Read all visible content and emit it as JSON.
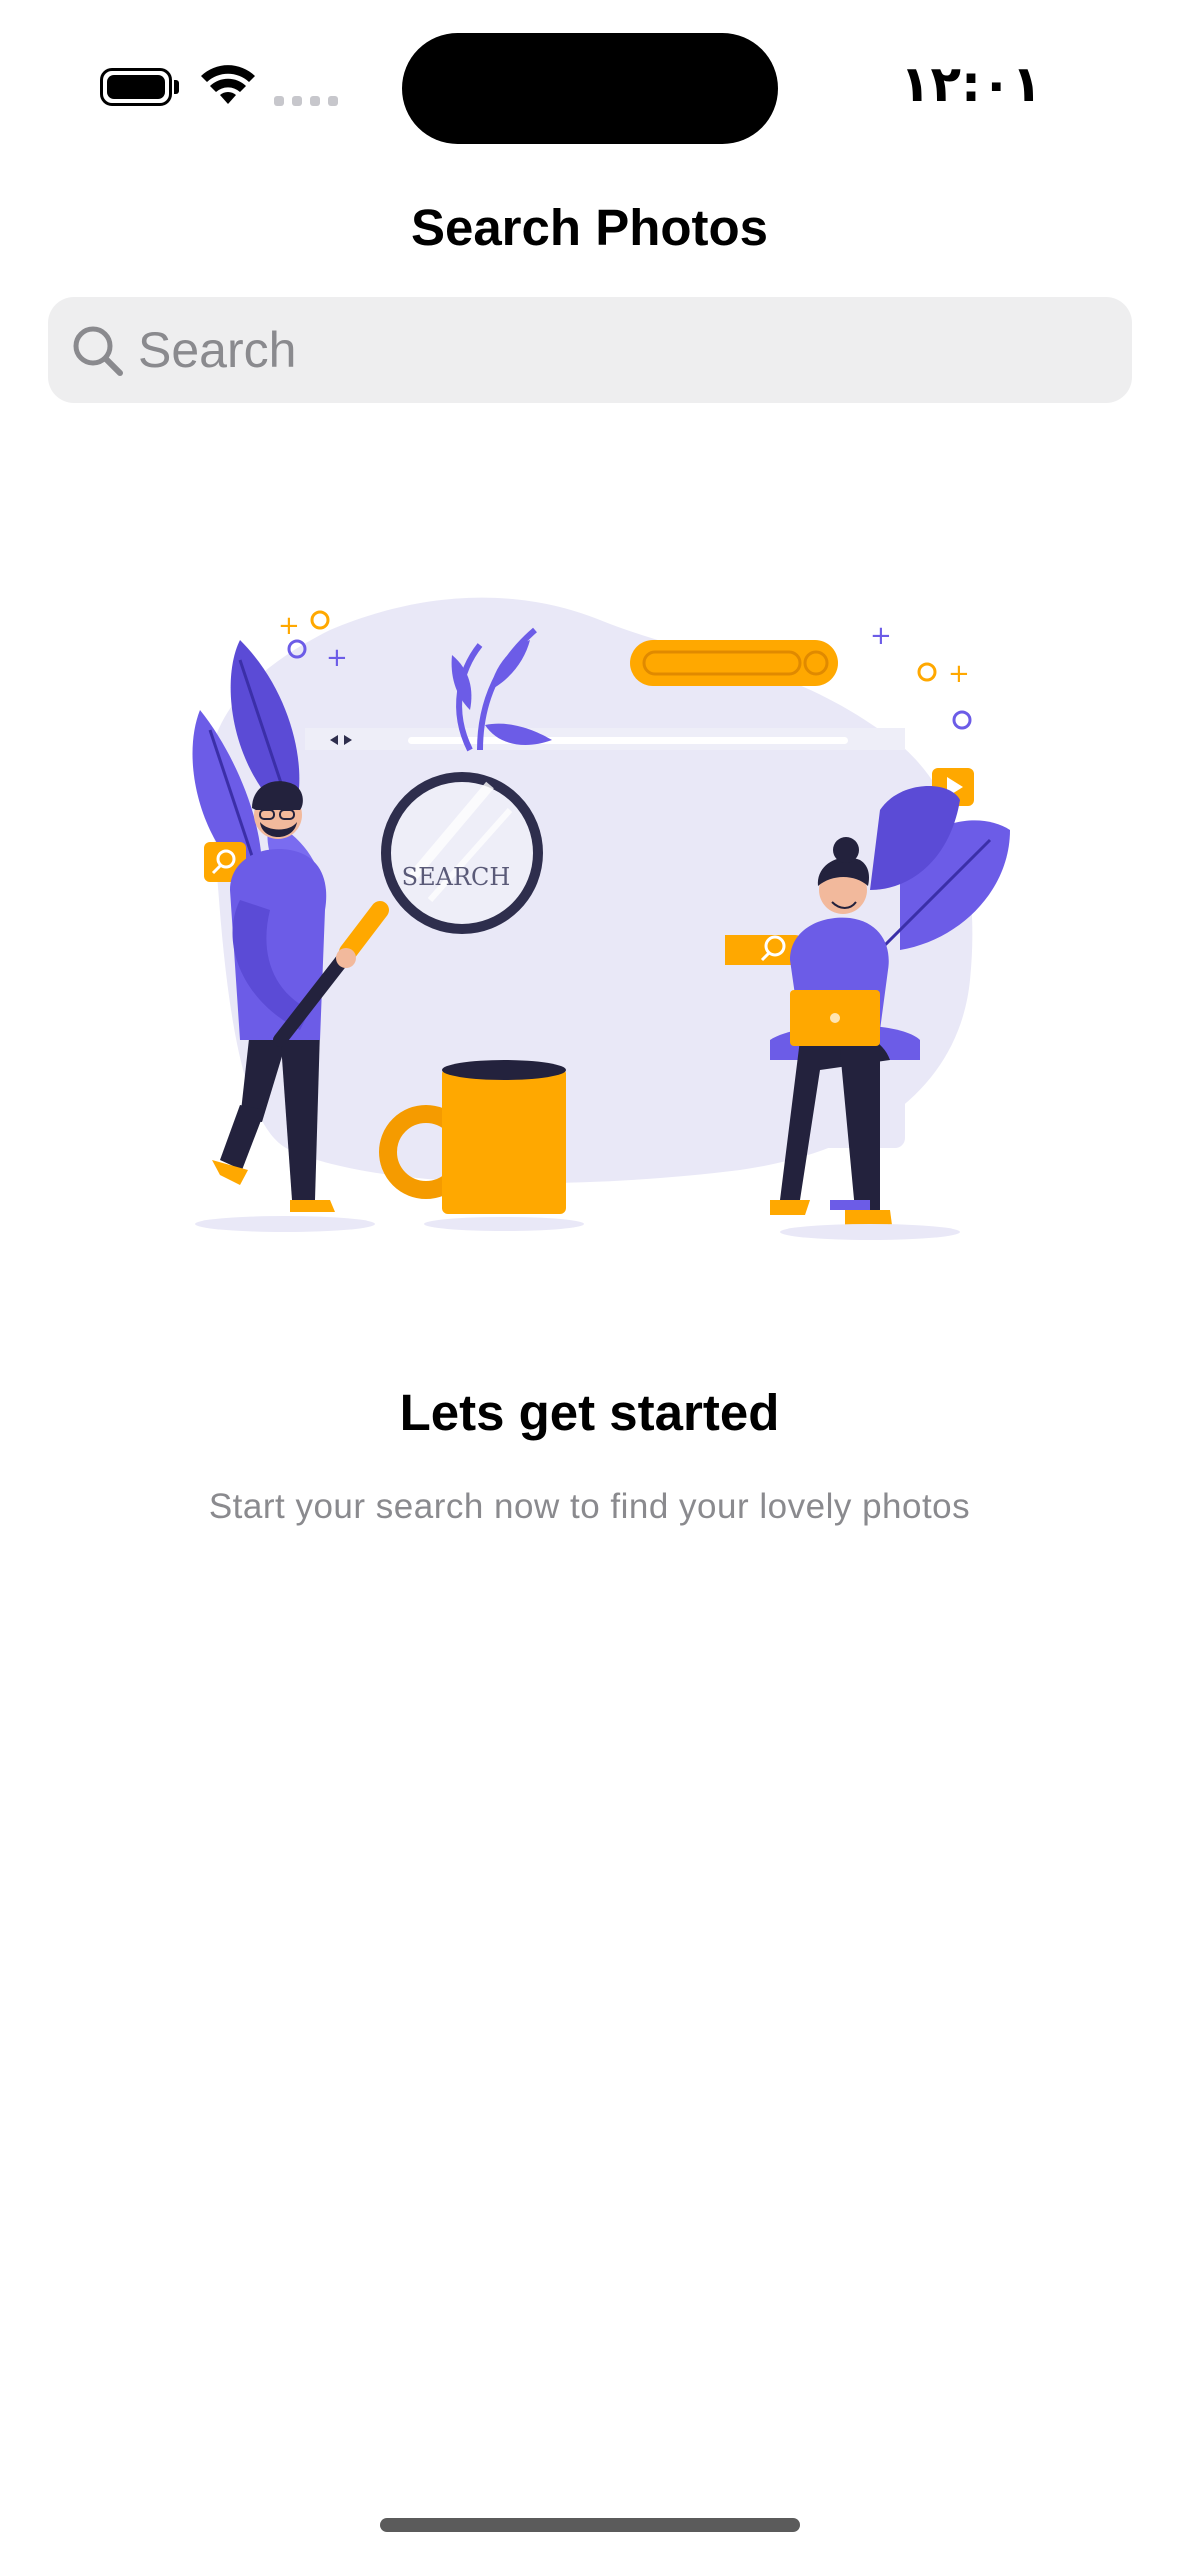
{
  "status_bar": {
    "time": "۱۲:۰۱",
    "icons": [
      "battery-icon",
      "wifi-icon",
      "cellular-signal-icon"
    ]
  },
  "nav": {
    "title": "Search Photos"
  },
  "search": {
    "placeholder": "Search",
    "value": ""
  },
  "illustration": {
    "magnifier_text": "SEARCH",
    "icon": "search-illustration"
  },
  "empty_state": {
    "title": "Lets get started",
    "subtitle": "Start your search now to find your lovely photos"
  },
  "colors": {
    "accent_purple": "#6c5ce7",
    "accent_orange": "#ffa800",
    "background_light": "#e9e8f7",
    "search_bg": "#eeeeef",
    "secondary_text": "#8a8a8e"
  }
}
